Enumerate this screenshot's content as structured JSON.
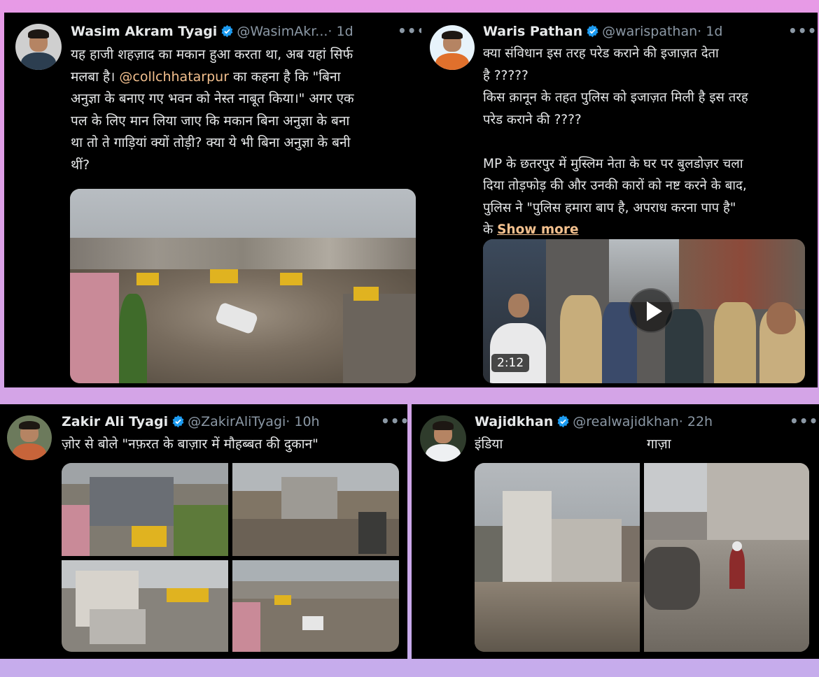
{
  "posts": [
    {
      "name": "Wasim Akram Tyagi",
      "handle": "@WasimAkr...",
      "time": "· 1d",
      "mention": "@collchhatarpur",
      "lines": [
        "यह हाजी शहज़ाद का मकान हुआ करता था, अब यहां सिर्फ",
        "मलबा है। ",
        " का कहना है कि \"बिना",
        "अनुज्ञा के बनाए गए भवन को नेस्त नाबूत किया।\" अगर एक",
        "पल के लिए मान लिया जाए कि मकान बिना अनुज्ञा के बना",
        "था तो ते गाड़ियां क्यों तोड़ी? क्या ये भी बिना अनुज्ञा के बनी",
        "थीं?"
      ]
    },
    {
      "name": "Waris Pathan",
      "handle": "@warispathan",
      "time": "· 1d",
      "lines": [
        "क्या संविधान इस तरह परेड कराने की इजाज़त देता",
        "है ?????",
        "किस क़ानून के तहत पुलिस को इजाज़त मिली है इस तरह",
        "परेड कराने की ????",
        "",
        "MP के छतरपुर में मुस्लिम नेता के घर पर बुलडोज़र चला",
        "दिया तोड़फोड़ की और उनकी कारों को नष्ट करने के बाद,",
        "पुलिस ने \"पुलिस हमारा बाप है, अपराध करना पाप है\"",
        "के "
      ],
      "show_more": "Show more",
      "video_duration": "2:12"
    },
    {
      "name": "Zakir Ali Tyagi",
      "handle": "@ZakirAliTyagi",
      "time": "· 10h",
      "lines": [
        "ज़ोर से बोले \"नफ़रत के बाज़ार में मौहब्बत की दुकान\""
      ]
    },
    {
      "name": "Wajidkhan",
      "handle": "@realwajidkhan",
      "time": "· 22h",
      "label_left": "इंडिया",
      "label_right": "गाज़ा"
    }
  ],
  "more_glyph": "•••",
  "colors": {
    "background": "#000000",
    "text": "#e7e9ea",
    "muted": "#8b98a5",
    "link": "#f3c08e",
    "verified": "#1d9bf0"
  },
  "icons": [
    "verified-badge-icon",
    "more-options-icon",
    "play-icon"
  ]
}
